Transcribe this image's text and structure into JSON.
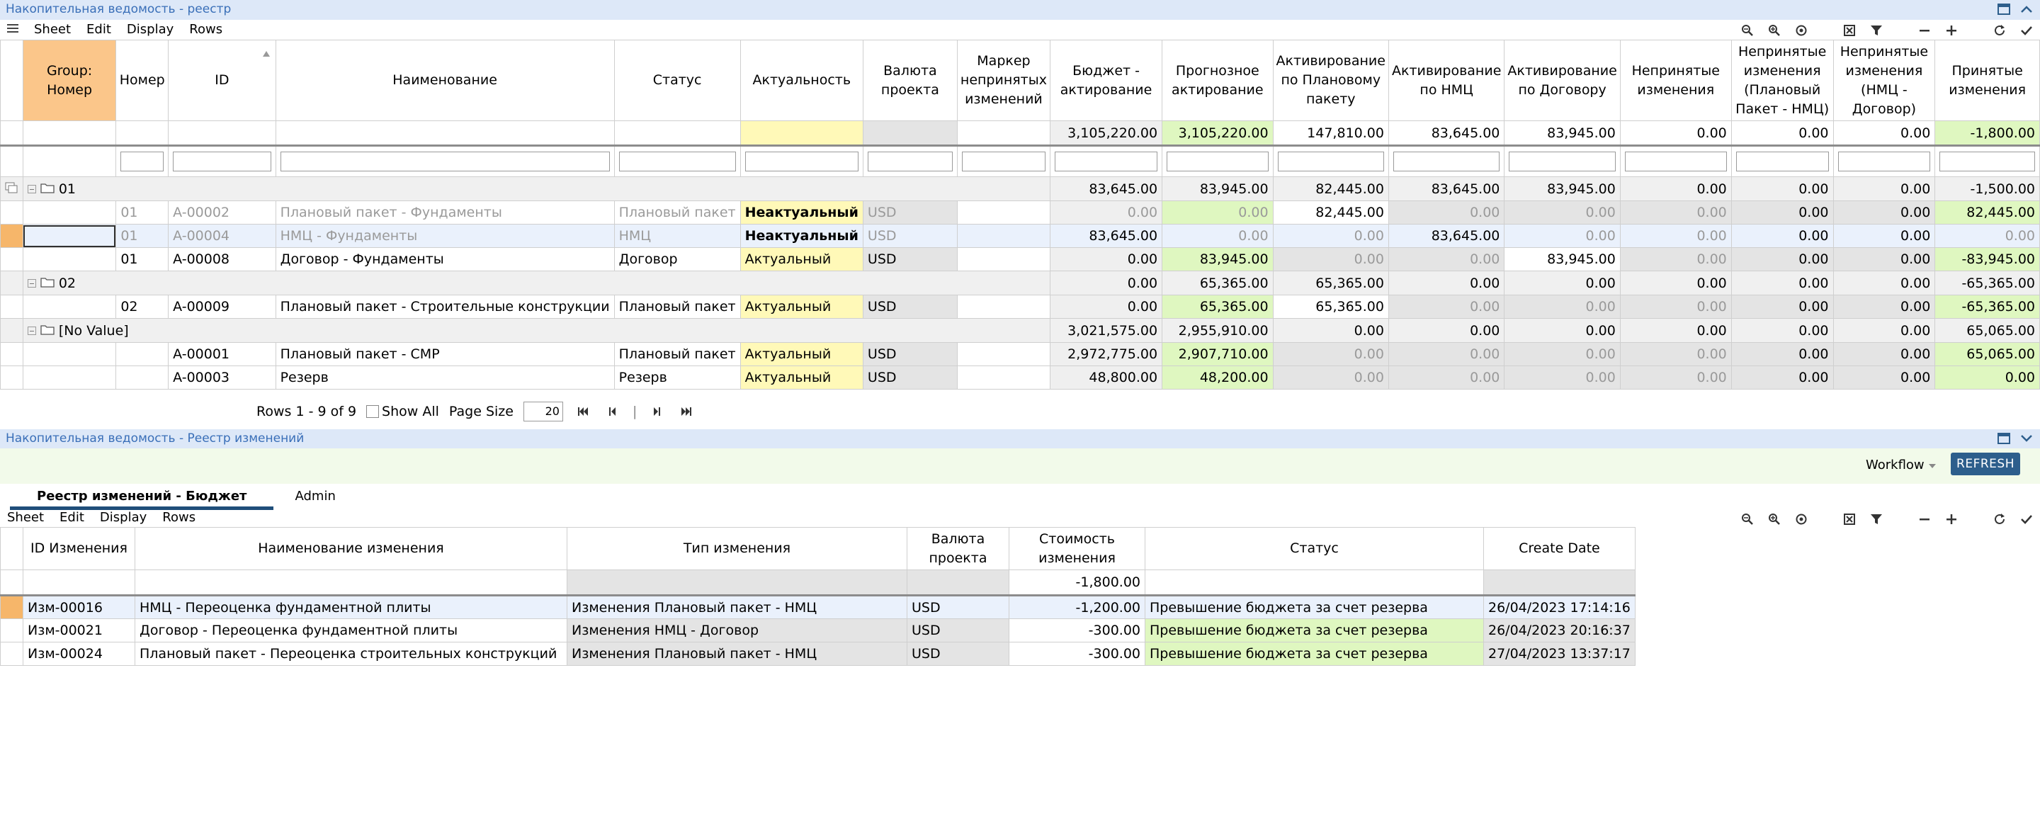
{
  "top_panel": {
    "title": "Накопительная ведомость - реестр",
    "menu": [
      "Sheet",
      "Edit",
      "Display",
      "Rows"
    ],
    "headers": {
      "group": "Group: Номер",
      "nomer": "Номер",
      "id": "ID",
      "name": "Наименование",
      "status": "Статус",
      "actual": "Актуальность",
      "currency": "Валюта проекта",
      "marker": "Маркер непринятых изменений",
      "budget": "Бюджет - актирование",
      "forecast": "Прогнозное актирование",
      "act_plan": "Активирование по Плановому пакету",
      "act_nmc": "Активирование по НМЦ",
      "act_contract": "Активирование по Договору",
      "unaccepted": "Непринятые изменения",
      "unaccepted_plan_nmc": "Непринятые изменения (Плановый Пакет - НМЦ)",
      "unaccepted_nmc_contract": "Непринятые изменения (НМЦ - Договор)",
      "accepted": "Принятые изменения"
    },
    "totals": {
      "budget": "3,105,220.00",
      "forecast": "3,105,220.00",
      "act_plan": "147,810.00",
      "act_nmc": "83,645.00",
      "act_contract": "83,945.00",
      "unaccepted": "0.00",
      "unaccepted_plan_nmc": "0.00",
      "unaccepted_nmc_contract": "0.00",
      "accepted": "-1,800.00"
    },
    "groups": [
      {
        "label": "01",
        "budget": "83,645.00",
        "forecast": "83,945.00",
        "act_plan": "82,445.00",
        "act_nmc": "83,645.00",
        "act_contract": "83,945.00",
        "unaccepted": "0.00",
        "unaccepted_plan_nmc": "0.00",
        "unaccepted_nmc_contract": "0.00",
        "accepted": "-1,500.00",
        "rows": [
          {
            "nomer": "01",
            "id": "A-00002",
            "name": "Плановый пакет - Фундаменты",
            "status": "Плановый пакет",
            "actual": "Неактуальный",
            "currency": "USD",
            "budget": "0.00",
            "forecast": "0.00",
            "act_plan": "82,445.00",
            "act_nmc": "0.00",
            "act_contract": "0.00",
            "unaccepted": "0.00",
            "unaccepted_plan_nmc": "0.00",
            "unaccepted_nmc_contract": "0.00",
            "accepted": "82,445.00"
          },
          {
            "nomer": "01",
            "id": "A-00004",
            "name": "НМЦ - Фундаменты",
            "status": "НМЦ",
            "actual": "Неактуальный",
            "currency": "USD",
            "budget": "83,645.00",
            "forecast": "0.00",
            "act_plan": "0.00",
            "act_nmc": "83,645.00",
            "act_contract": "0.00",
            "unaccepted": "0.00",
            "unaccepted_plan_nmc": "0.00",
            "unaccepted_nmc_contract": "0.00",
            "accepted": "0.00"
          },
          {
            "nomer": "01",
            "id": "A-00008",
            "name": "Договор - Фундаменты",
            "status": "Договор",
            "actual": "Актуальный",
            "currency": "USD",
            "budget": "0.00",
            "forecast": "83,945.00",
            "act_plan": "0.00",
            "act_nmc": "0.00",
            "act_contract": "83,945.00",
            "unaccepted": "0.00",
            "unaccepted_plan_nmc": "0.00",
            "unaccepted_nmc_contract": "0.00",
            "accepted": "-83,945.00"
          }
        ]
      },
      {
        "label": "02",
        "budget": "0.00",
        "forecast": "65,365.00",
        "act_plan": "65,365.00",
        "act_nmc": "0.00",
        "act_contract": "0.00",
        "unaccepted": "0.00",
        "unaccepted_plan_nmc": "0.00",
        "unaccepted_nmc_contract": "0.00",
        "accepted": "-65,365.00",
        "rows": [
          {
            "nomer": "02",
            "id": "A-00009",
            "name": "Плановый пакет - Строительные конструкции",
            "status": "Плановый пакет",
            "actual": "Актуальный",
            "currency": "USD",
            "budget": "0.00",
            "forecast": "65,365.00",
            "act_plan": "65,365.00",
            "act_nmc": "0.00",
            "act_contract": "0.00",
            "unaccepted": "0.00",
            "unaccepted_plan_nmc": "0.00",
            "unaccepted_nmc_contract": "0.00",
            "accepted": "-65,365.00"
          }
        ]
      },
      {
        "label": "[No Value]",
        "budget": "3,021,575.00",
        "forecast": "2,955,910.00",
        "act_plan": "0.00",
        "act_nmc": "0.00",
        "act_contract": "0.00",
        "unaccepted": "0.00",
        "unaccepted_plan_nmc": "0.00",
        "unaccepted_nmc_contract": "0.00",
        "accepted": "65,065.00",
        "rows": [
          {
            "nomer": "",
            "id": "A-00001",
            "name": "Плановый пакет - СМР",
            "status": "Плановый пакет",
            "actual": "Актуальный",
            "currency": "USD",
            "budget": "2,972,775.00",
            "forecast": "2,907,710.00",
            "act_plan": "0.00",
            "act_nmc": "0.00",
            "act_contract": "0.00",
            "unaccepted": "0.00",
            "unaccepted_plan_nmc": "0.00",
            "unaccepted_nmc_contract": "0.00",
            "accepted": "65,065.00"
          },
          {
            "nomer": "",
            "id": "A-00003",
            "name": "Резерв",
            "status": "Резерв",
            "actual": "Актуальный",
            "currency": "USD",
            "budget": "48,800.00",
            "forecast": "48,200.00",
            "act_plan": "0.00",
            "act_nmc": "0.00",
            "act_contract": "0.00",
            "unaccepted": "0.00",
            "unaccepted_plan_nmc": "0.00",
            "unaccepted_nmc_contract": "0.00",
            "accepted": "0.00"
          }
        ]
      }
    ],
    "pager": {
      "rows_text": "Rows 1 - 9 of 9",
      "show_all": "Show All",
      "page_size_label": "Page Size",
      "page_size": "20"
    }
  },
  "lower_panel": {
    "title": "Накопительная ведомость - Реестр изменений",
    "workflow": "Workflow",
    "refresh": "REFRESH",
    "tabs": [
      "Реестр изменений - Бюджет",
      "Admin"
    ],
    "menu": [
      "Sheet",
      "Edit",
      "Display",
      "Rows"
    ],
    "headers": {
      "change_id": "ID Изменения",
      "change_name": "Наименование изменения",
      "change_type": "Тип изменения",
      "currency": "Валюта проекта",
      "cost": "Стоимость изменения",
      "status": "Статус",
      "create_date": "Create Date"
    },
    "total_cost": "-1,800.00",
    "rows": [
      {
        "change_id": "Изм-00016",
        "change_name": "НМЦ - Переоценка фундаментной плиты",
        "change_type": "Изменения Плановый пакет - НМЦ",
        "currency": "USD",
        "cost": "-1,200.00",
        "status": "Превышение бюджета за счет резерва",
        "create_date": "26/04/2023 17:14:16"
      },
      {
        "change_id": "Изм-00021",
        "change_name": "Договор - Переоценка фундаментной плиты",
        "change_type": "Изменения НМЦ - Договор",
        "currency": "USD",
        "cost": "-300.00",
        "status": "Превышение бюджета за счет резерва",
        "create_date": "26/04/2023 20:16:37"
      },
      {
        "change_id": "Изм-00024",
        "change_name": "Плановый пакет - Переоценка строительных конструкций",
        "change_type": "Изменения Плановый пакет - НМЦ",
        "currency": "USD",
        "cost": "-300.00",
        "status": "Превышение бюджета за счет резерва",
        "create_date": "27/04/2023 13:37:17"
      }
    ]
  },
  "colors": {
    "group_header": "#fbc68a",
    "green_cell": "#dff7c0",
    "yellow_cell": "#fff9b8",
    "titlebar": "#dde8f8",
    "refresh_button": "#2d5e8c"
  }
}
